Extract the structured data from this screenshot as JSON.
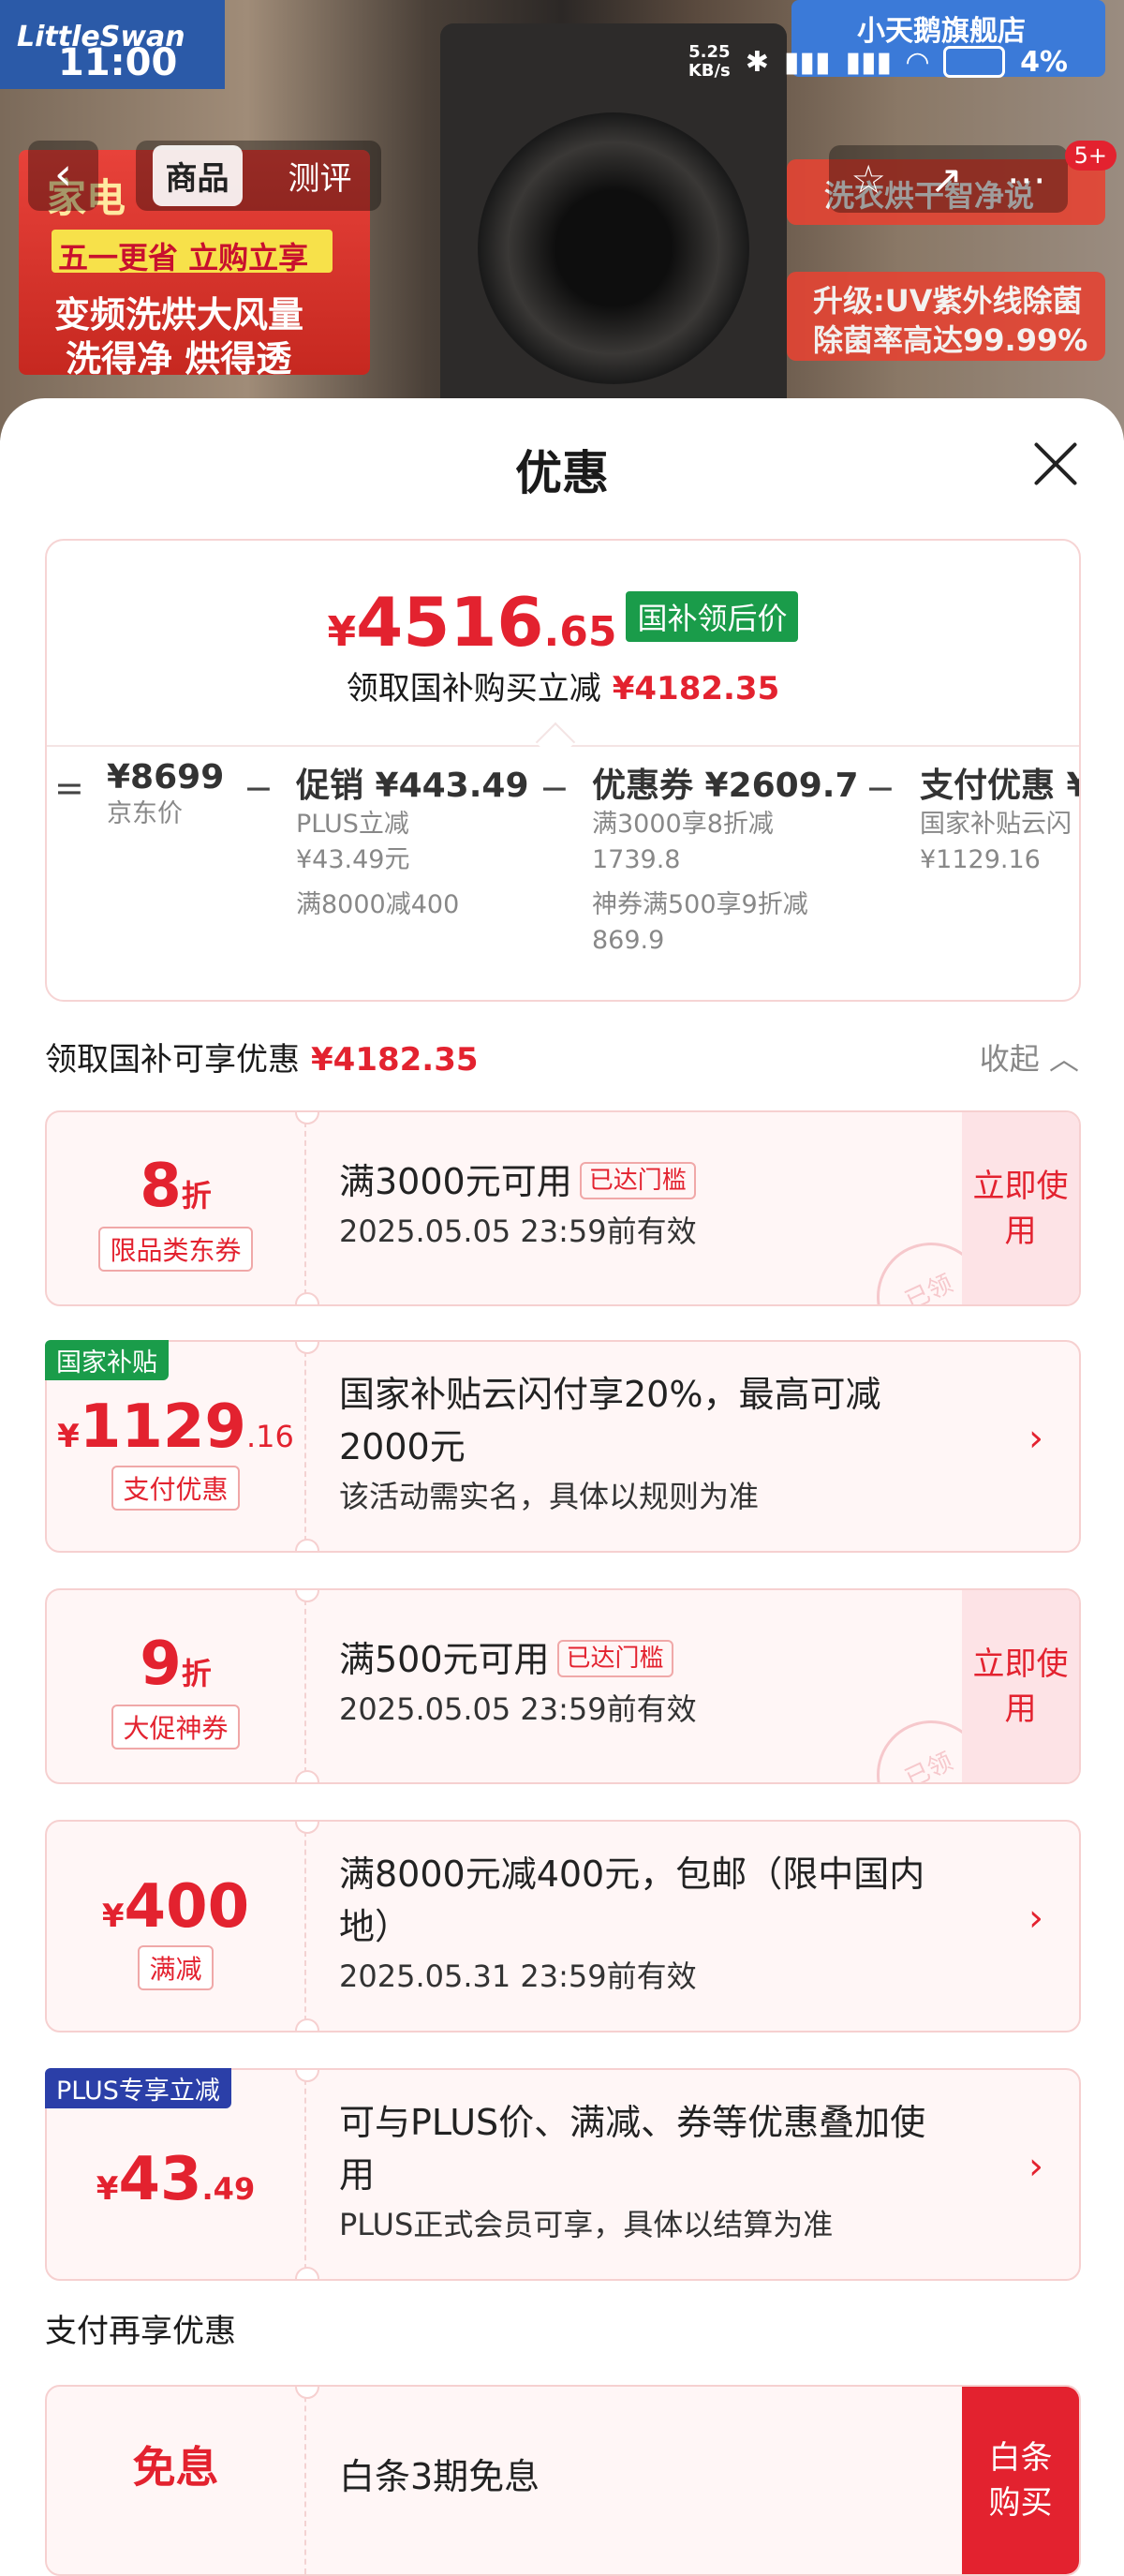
{
  "status": {
    "time": "11:00",
    "speed_value": "5.25",
    "speed_unit": "KB/s",
    "battery": "4%"
  },
  "background": {
    "logo": "LittleSwan",
    "banner_line1": "家电",
    "banner_line2": "五一更省 立购立享",
    "banner_line3": "变频洗烘大风量",
    "banner_line4": "洗得净 烘得透",
    "store": "小天鹅旗舰店",
    "right_line1": "洗衣烘干智净说",
    "right_line2": "升级:UV紫外线除菌",
    "right_line3": "除菌率高达99.99%"
  },
  "nav": {
    "tabs": [
      "商品",
      "测评"
    ],
    "active_tab": "商品",
    "badge": "5+"
  },
  "sheet": {
    "title": "优惠",
    "summary": {
      "yen": "¥",
      "price_int": "4516",
      "price_dec": ".65",
      "price_tag": "国补领后价",
      "sub_text": "领取国补购买立减",
      "sub_amount": "¥4182.35",
      "breakdown": [
        {
          "op": "=",
          "main": "¥8699",
          "subs": [
            "京东价"
          ]
        },
        {
          "op": "−",
          "main": "促销 ¥443.49",
          "subs": [
            "PLUS立减",
            "¥43.49元",
            "满8000减400"
          ]
        },
        {
          "op": "−",
          "main": "优惠券 ¥2609.7",
          "subs": [
            "满3000享8折减",
            "1739.8",
            "神券满500享9折减",
            "869.9"
          ]
        },
        {
          "op": "−",
          "main": "支付优惠 ¥",
          "subs": [
            "国家补贴云闪",
            "¥1129.16"
          ]
        }
      ]
    },
    "section1": {
      "title": "领取国补可享优惠",
      "amount": "¥4182.35",
      "collapse": "收起"
    },
    "coupons": [
      {
        "value": "8",
        "unit": "折",
        "label": "限品类东券",
        "main": "满3000元可用",
        "reached": "已达门槛",
        "sub": "2025.05.05 23:59前有效",
        "action": "立即使用",
        "stamp": "已领"
      },
      {
        "corner": "国家补贴",
        "yen": "¥",
        "value_int": "1129",
        "value_dec": ".16",
        "label": "支付优惠",
        "main": "国家补贴云闪付享20%，最高可减2000元",
        "sub": "该活动需实名，具体以规则为准"
      },
      {
        "value": "9",
        "unit": "折",
        "label": "大促神券",
        "main": "满500元可用",
        "reached": "已达门槛",
        "sub": "2025.05.05 23:59前有效",
        "action": "立即使用",
        "stamp": "已领"
      },
      {
        "yen": "¥",
        "value_int": "400",
        "label": "满减",
        "main": "满8000元减400元，包邮（限中国内地）",
        "sub": "2025.05.31 23:59前有效"
      },
      {
        "corner": "PLUS专享立减",
        "yen": "¥",
        "value_int": "43",
        "value_dec": ".49",
        "main": "可与PLUS价、满减、券等优惠叠加使用",
        "sub": "PLUS正式会员可享，具体以结算为准"
      }
    ],
    "section2": {
      "title": "支付再享优惠"
    },
    "payment": {
      "value": "免息",
      "main": "白条3期免息",
      "action": "白条购买"
    }
  },
  "colors": {
    "accent_red": "#e3222f",
    "green_tag": "#1a9c4a",
    "plus_blue": "#2b3fa8"
  }
}
